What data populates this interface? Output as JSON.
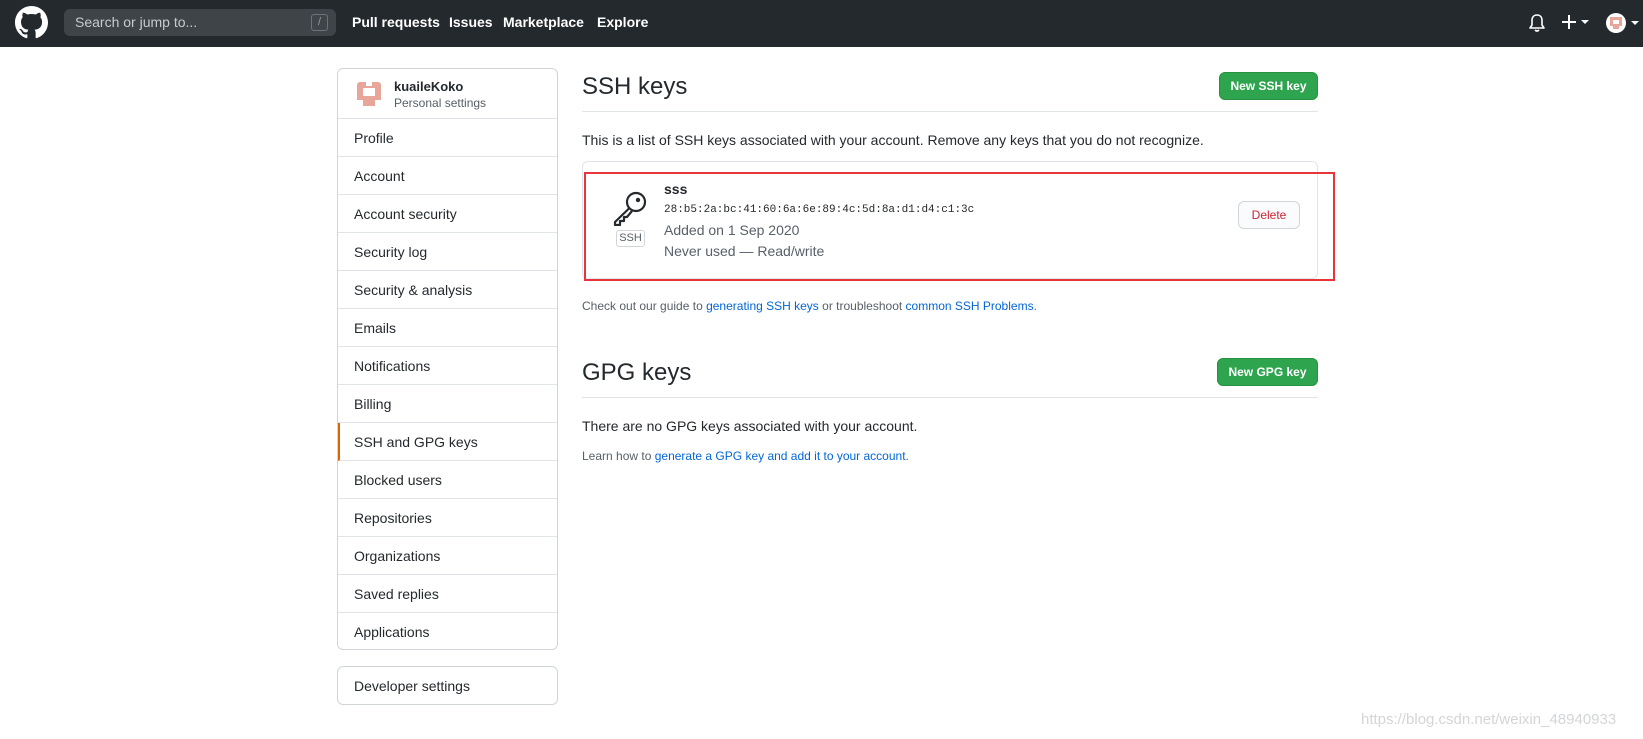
{
  "header": {
    "search_placeholder": "Search or jump to...",
    "search_shortcut": "/",
    "nav": [
      "Pull requests",
      "Issues",
      "Marketplace",
      "Explore"
    ]
  },
  "sidebar": {
    "username": "kuaileKoko",
    "subtitle": "Personal settings",
    "items": [
      {
        "label": "Profile"
      },
      {
        "label": "Account"
      },
      {
        "label": "Account security"
      },
      {
        "label": "Security log"
      },
      {
        "label": "Security & analysis"
      },
      {
        "label": "Emails"
      },
      {
        "label": "Notifications"
      },
      {
        "label": "Billing"
      },
      {
        "label": "SSH and GPG keys",
        "selected": true
      },
      {
        "label": "Blocked users"
      },
      {
        "label": "Repositories"
      },
      {
        "label": "Organizations"
      },
      {
        "label": "Saved replies"
      },
      {
        "label": "Applications"
      }
    ],
    "developer_settings": "Developer settings"
  },
  "ssh": {
    "title": "SSH keys",
    "new_button": "New SSH key",
    "intro": "This is a list of SSH keys associated with your account. Remove any keys that you do not recognize.",
    "key": {
      "type_label": "SSH",
      "name": "sss",
      "fingerprint": "28:b5:2a:bc:41:60:6a:6e:89:4c:5d:8a:d1:d4:c1:3c",
      "added": "Added on 1 Sep 2020",
      "usage": "Never used — Read/write",
      "delete_label": "Delete"
    },
    "guide_prefix": "Check out our guide to ",
    "guide_link1": "generating SSH keys",
    "guide_mid": " or troubleshoot ",
    "guide_link2": "common SSH Problems",
    "guide_suffix": "."
  },
  "gpg": {
    "title": "GPG keys",
    "new_button": "New GPG key",
    "empty": "There are no GPG keys associated with your account.",
    "learn_prefix": "Learn how to ",
    "learn_link": "generate a GPG key and add it to your account",
    "learn_suffix": "."
  },
  "watermark": "https://blog.csdn.net/weixin_48940933",
  "colors": {
    "header_bg": "#24292e",
    "primary_green": "#2ea44f",
    "link_blue": "#0366d6",
    "danger_red": "#cb2431",
    "highlight_red": "#e8343b",
    "selected_accent": "#e36209"
  }
}
